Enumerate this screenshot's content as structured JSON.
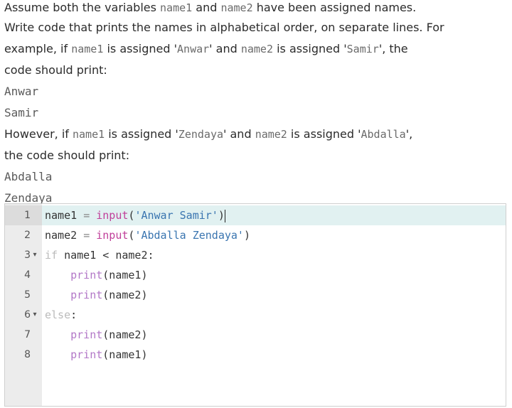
{
  "prompt": {
    "l1_a": "Assume both the variables ",
    "l1_b": "name1",
    "l1_c": " and ",
    "l1_d": "name2",
    "l1_e": " have been assigned names.",
    "l2": "Write code that prints the names in alphabetical order, on separate lines. For",
    "l3_a": "example, if ",
    "l3_b": "name1",
    "l3_c": " is assigned '",
    "l3_d": "Anwar",
    "l3_e": "' and ",
    "l3_f": "name2",
    "l3_g": " is assigned '",
    "l3_h": "Samir",
    "l3_i": "', the",
    "l4": "code should print:",
    "out1a": "Anwar",
    "out1b": "Samir",
    "l5_a": "However, if ",
    "l5_b": "name1",
    "l5_c": " is assigned '",
    "l5_d": "Zendaya",
    "l5_e": "' and ",
    "l5_f": "name2",
    "l5_g": " is assigned '",
    "l5_h": "Abdalla",
    "l5_i": "',",
    "l6": "the code should print:",
    "out2a": "Abdalla",
    "out2b": "Zendaya"
  },
  "editor": {
    "lines": [
      {
        "num": "1",
        "fold": "",
        "t1": "name1 ",
        "t2": "=",
        "t3": " ",
        "t4": "input",
        "t5": "(",
        "t6": "'Anwar Samir'",
        "t7": ")"
      },
      {
        "num": "2",
        "fold": "",
        "t1": "name2 ",
        "t2": "=",
        "t3": " ",
        "t4": "input",
        "t5": "(",
        "t6": "'Abdalla Zendaya'",
        "t7": ")"
      },
      {
        "num": "3",
        "fold": "▾",
        "t1": "if",
        "t2": " name1 < name2:"
      },
      {
        "num": "4",
        "fold": "",
        "indent": "    ",
        "t1": "print",
        "t2": "(name1)"
      },
      {
        "num": "5",
        "fold": "",
        "indent": "    ",
        "t1": "print",
        "t2": "(name2)"
      },
      {
        "num": "6",
        "fold": "▾",
        "t1": "else",
        "t2": ":"
      },
      {
        "num": "7",
        "fold": "",
        "indent": "    ",
        "t1": "print",
        "t2": "(name2)"
      },
      {
        "num": "8",
        "fold": "",
        "indent": "    ",
        "t1": "print",
        "t2": "(name1)"
      }
    ]
  }
}
